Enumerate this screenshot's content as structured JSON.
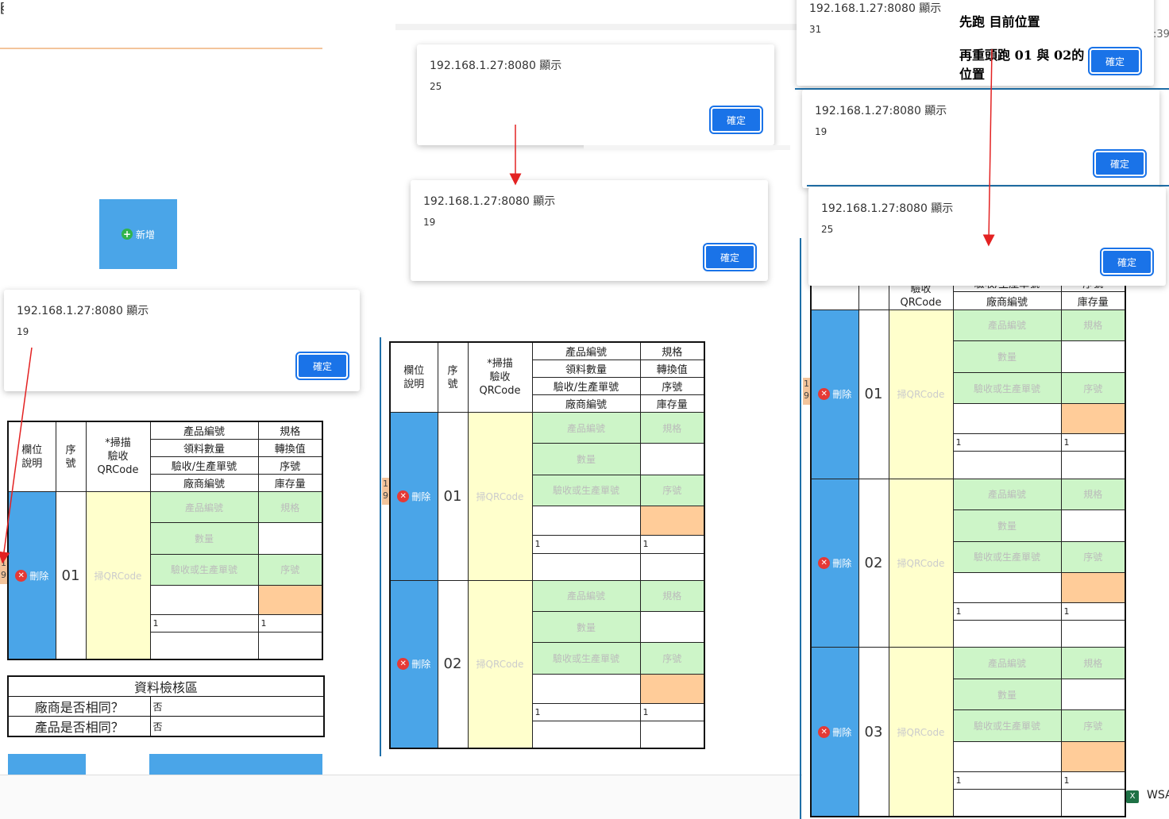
{
  "browser": {
    "tab_stub": "[",
    "clock_stub": ":39",
    "taskbar_app": "WSA"
  },
  "dialog_origin": "192.168.1.27:8080 顯示",
  "ok_label": "確定",
  "dialogs": [
    {
      "id": "d1",
      "value": "25"
    },
    {
      "id": "d2",
      "value": "19"
    },
    {
      "id": "d3",
      "value": "19"
    },
    {
      "id": "d4",
      "value": "31"
    },
    {
      "id": "d5",
      "value": "19"
    },
    {
      "id": "d6",
      "value": "25"
    }
  ],
  "annotation": {
    "line1": "先跑 目前位置",
    "line2": "再重頭跑 01 與 02的",
    "line3": "位置"
  },
  "add_button": {
    "label": "新增"
  },
  "table_header": {
    "field_desc": "欄位\n說明",
    "seq": "序\n號",
    "scan": "*掃描\n驗收\nQRCode",
    "product_no": "產品編號",
    "spec": "規格",
    "qty": "領料數量",
    "conv": "轉換值",
    "receipt": "驗收/生產單號",
    "serial": "序號",
    "vendor": "廠商編號",
    "stock": "庫存量"
  },
  "row": {
    "delete_label": "刪除",
    "qr_placeholder": "掃QRCode",
    "product_placeholder": "產品編號",
    "spec_placeholder": "規格",
    "qty_placeholder": "數量",
    "receipt_placeholder": "驗收或生產單號",
    "serial_placeholder": "序號",
    "value_a": "1",
    "value_b": "1"
  },
  "side_badge": "1\n9",
  "check_area": {
    "title": "資料檢核區",
    "vendor_same": "廠商是否相同？",
    "vendor_val": "否",
    "product_same": "產品是否相同？",
    "product_val": "否"
  },
  "seq_numbers": [
    "01",
    "02",
    "03"
  ]
}
